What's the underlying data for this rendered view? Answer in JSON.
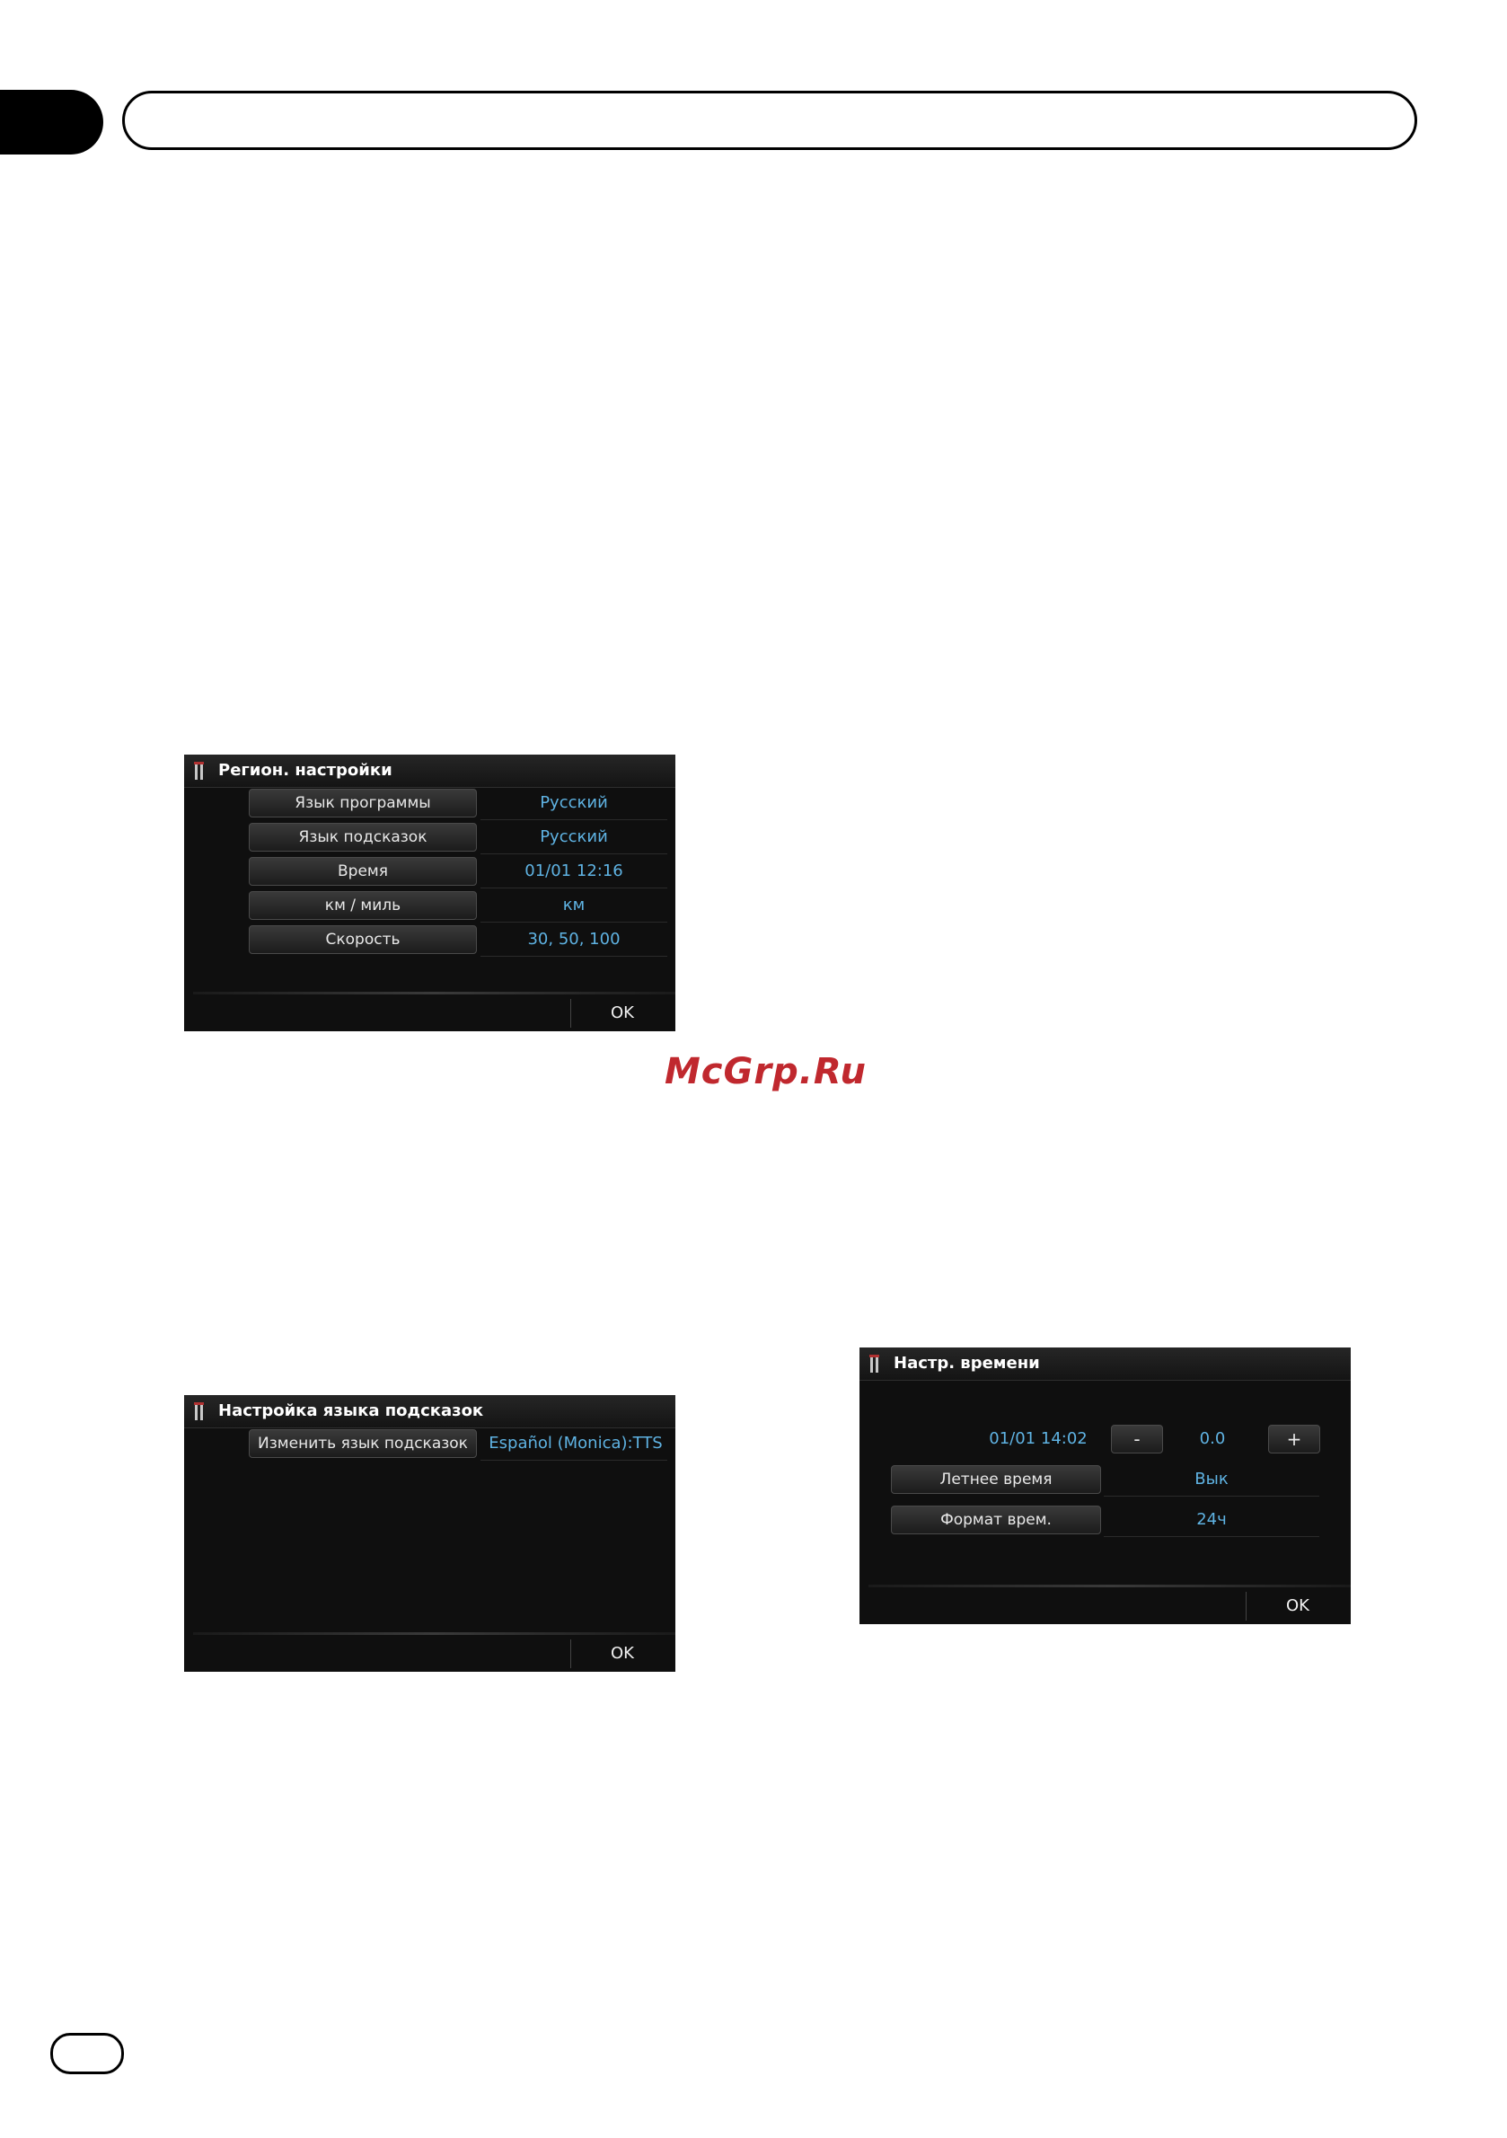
{
  "watermark": "McGrp.Ru",
  "screen1": {
    "title": "Регион. настройки",
    "rows": [
      {
        "label": "Язык программы",
        "value": "Русский"
      },
      {
        "label": "Язык подсказок",
        "value": "Русский"
      },
      {
        "label": "Время",
        "value": "01/01 12:16"
      },
      {
        "label": "км / миль",
        "value": "км"
      },
      {
        "label": "Скорость",
        "value": "30, 50, 100"
      }
    ],
    "ok": "OK"
  },
  "screen2": {
    "title": "Настройка языка подсказок",
    "row": {
      "label": "Изменить язык подсказок",
      "value": "Español (Monica):TTS"
    },
    "ok": "OK"
  },
  "screen3": {
    "title": "Настр. времени",
    "time": "01/01 14:02",
    "minus": "-",
    "offset": "0.0",
    "plus": "+",
    "rows": [
      {
        "label": "Летнее время",
        "value": "Вык"
      },
      {
        "label": "Формат врем.",
        "value": "24ч"
      }
    ],
    "ok": "OK"
  }
}
